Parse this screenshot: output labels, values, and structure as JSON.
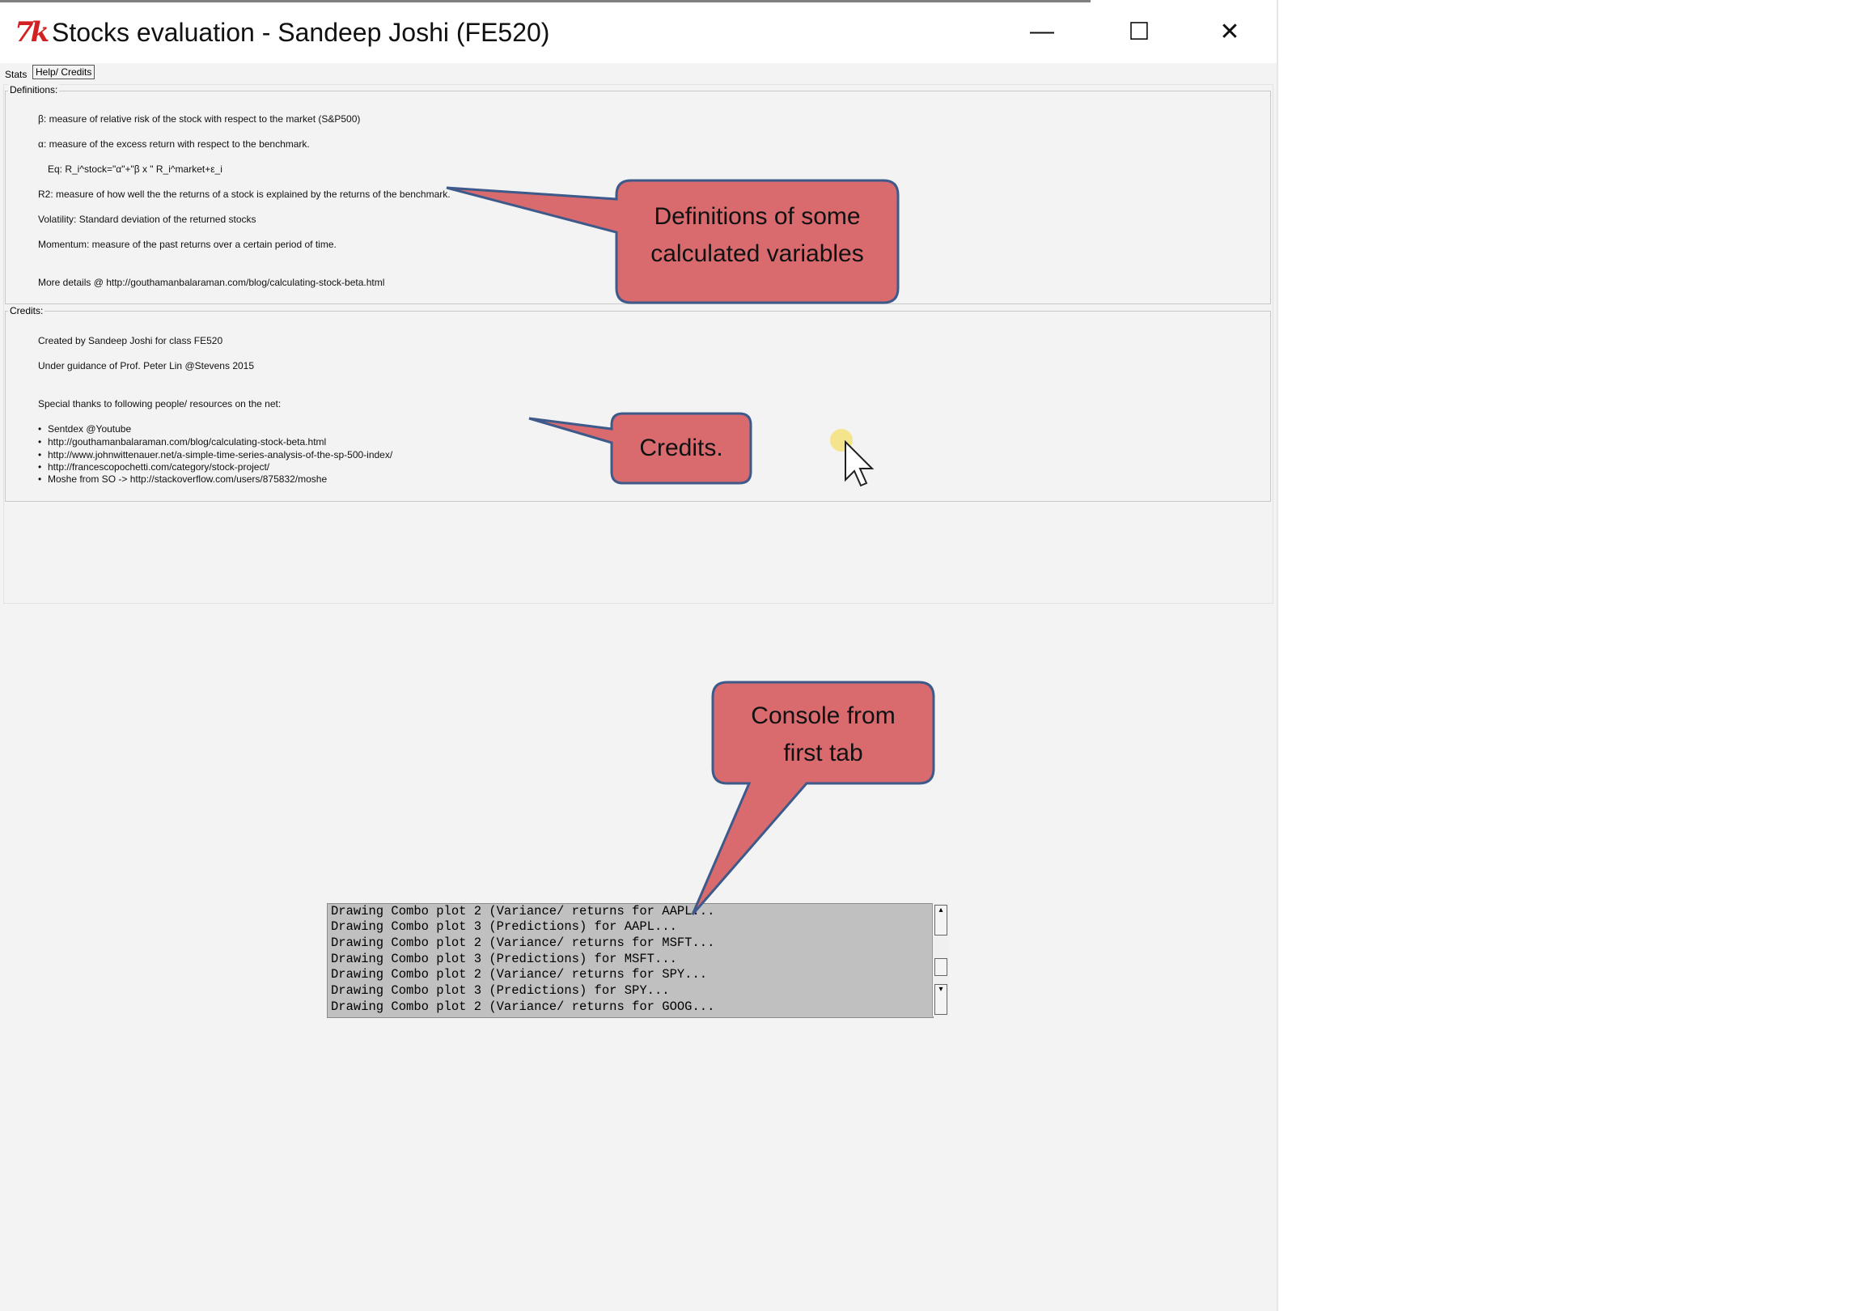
{
  "window": {
    "title": "Stocks evaluation - Sandeep Joshi (FE520)",
    "app_icon_text": "7k",
    "minimize_symbol": "—",
    "maximize_symbol": "☐",
    "close_symbol": "✕"
  },
  "tabs": [
    {
      "label": "Stats",
      "selected": false
    },
    {
      "label": "Help/ Credits",
      "selected": true
    }
  ],
  "definitions": {
    "label": "Definitions:",
    "lines": [
      "β: measure of relative risk of the stock with respect to the market (S&P500)",
      "α: measure of the excess return with respect to the benchmark.",
      "Eq: R_i^stock=\"α\"+\"β x \" R_i^market+ε_i",
      "R2: measure of how well the the returns of a stock is explained by the returns of the benchmark.",
      "Volatility: Standard deviation of the returned stocks",
      "Momentum: measure of the past returns over a certain period of time.",
      "More details @ http://gouthamanbalaraman.com/blog/calculating-stock-beta.html"
    ]
  },
  "credits": {
    "label": "Credits:",
    "lines": [
      "Created by Sandeep Joshi for class FE520",
      "Under guidance of Prof. Peter Lin @Stevens 2015",
      "Special thanks to following people/ resources on the net:"
    ],
    "bullets": [
      "Sentdex @Youtube",
      "http://gouthamanbalaraman.com/blog/calculating-stock-beta.html",
      "http://www.johnwittenauer.net/a-simple-time-series-analysis-of-the-sp-500-index/",
      "http://francescopochetti.com/category/stock-project/",
      "Moshe from SO -> http://stackoverflow.com/users/875832/moshe"
    ],
    "bullet_symbol": "•"
  },
  "console": {
    "lines": [
      "Drawing Combo plot 2 (Variance/ returns for AAPL...",
      "Drawing Combo plot 3 (Predictions) for AAPL...",
      "Drawing Combo plot 2 (Variance/ returns for MSFT...",
      "Drawing Combo plot 3 (Predictions) for MSFT...",
      "Drawing Combo plot 2 (Variance/ returns for SPY...",
      "Drawing Combo plot 3 (Predictions) for SPY...",
      "Drawing Combo plot 2 (Variance/ returns for GOOG..."
    ],
    "scroll_up_symbol": "▴",
    "scroll_down_symbol": "▾"
  },
  "callouts": {
    "definitions": [
      "Definitions of some",
      "calculated variables"
    ],
    "credits": [
      "Credits."
    ],
    "console": [
      "Console from",
      "first tab"
    ]
  },
  "colors": {
    "callout_fill": "#d96b6f",
    "callout_stroke": "#3d5a8a",
    "window_bg": "#f3f3f3",
    "console_bg": "#c0c0c0",
    "cursor_highlight": "#f3e27a"
  }
}
